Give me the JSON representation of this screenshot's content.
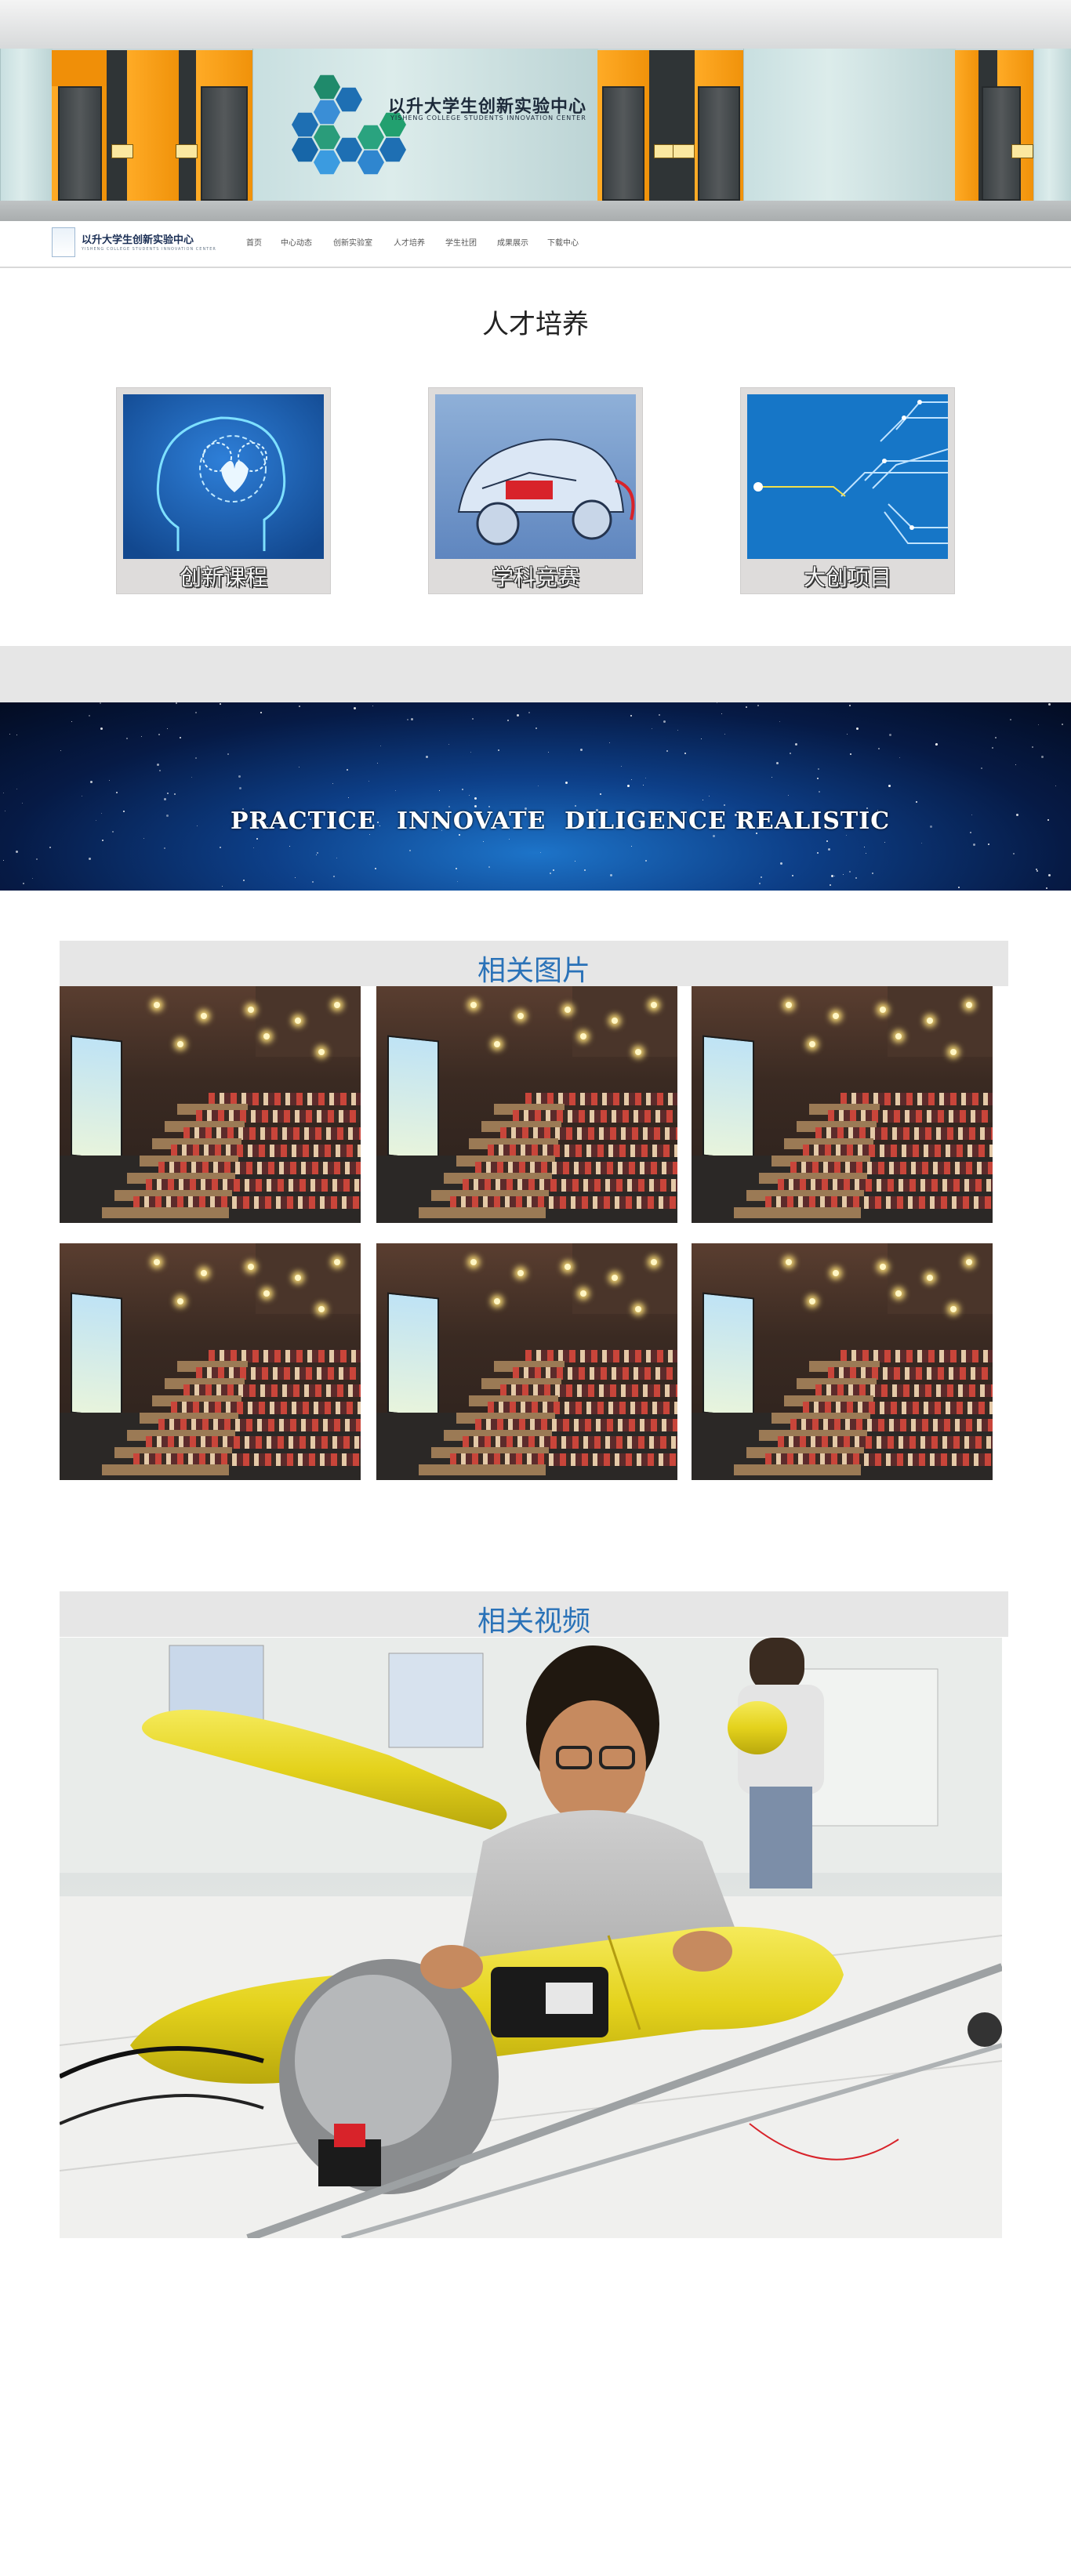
{
  "hero": {
    "logo_cn": "以升大学生创新实验中心",
    "logo_en": "YISHENG COLLEGE STUDENTS INNOVATION CENTER"
  },
  "nav": {
    "logo_cn": "以升大学生创新实验中心",
    "logo_en": "YISHENG COLLEGE STUDENTS INNOVATION CENTER",
    "items": [
      "首页",
      "中心动态",
      "创新实验室",
      "人才培养",
      "学生社团",
      "成果展示",
      "下载中心"
    ]
  },
  "talent": {
    "title": "人才培养",
    "cards": [
      {
        "label": "创新课程"
      },
      {
        "label": "学科竞赛"
      },
      {
        "label": "大创项目"
      }
    ]
  },
  "values_banner": {
    "words": [
      "PRACTICE",
      "INNOVATE",
      "DILIGENCE",
      "REALISTIC"
    ]
  },
  "gallery": {
    "title": "相关图片"
  },
  "video": {
    "title": "相关视频"
  },
  "colors": {
    "accent": "#2a72b8",
    "orange": "#f5a01a",
    "bar": "#e6e6e6"
  }
}
